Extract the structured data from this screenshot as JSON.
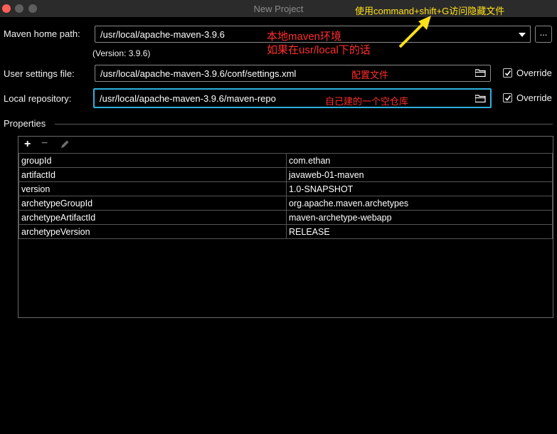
{
  "window": {
    "title": "New Project"
  },
  "maven_home": {
    "label": "Maven home path:",
    "value": "/usr/local/apache-maven-3.9.6",
    "version_text": "(Version: 3.9.6)",
    "browse_label": "..."
  },
  "user_settings": {
    "label": "User settings file:",
    "value": "/usr/local/apache-maven-3.9.6/conf/settings.xml",
    "override_label": "Override",
    "override_checked": true
  },
  "local_repo": {
    "label": "Local repository:",
    "value": "/usr/local/apache-maven-3.9.6/maven-repo",
    "override_label": "Override",
    "override_checked": true
  },
  "properties": {
    "title": "Properties",
    "rows": [
      {
        "key": "groupId",
        "value": "com.ethan"
      },
      {
        "key": "artifactId",
        "value": "javaweb-01-maven"
      },
      {
        "key": "version",
        "value": "1.0-SNAPSHOT"
      },
      {
        "key": "archetypeGroupId",
        "value": "org.apache.maven.archetypes"
      },
      {
        "key": "archetypeArtifactId",
        "value": "maven-archetype-webapp"
      },
      {
        "key": "archetypeVersion",
        "value": "RELEASE"
      }
    ]
  },
  "annotations": {
    "shortcut_hint": "使用command+shift+G访问隐藏文件",
    "local_env": "本地maven环境",
    "if_local": "如果在usr/local下的话",
    "config_file": "配置文件",
    "own_repo": "自己建的一个空仓库"
  },
  "colors": {
    "annotation_red": "#ff2d2d",
    "annotation_yellow": "#ffe01a",
    "focus_border": "#2fb0e0"
  }
}
